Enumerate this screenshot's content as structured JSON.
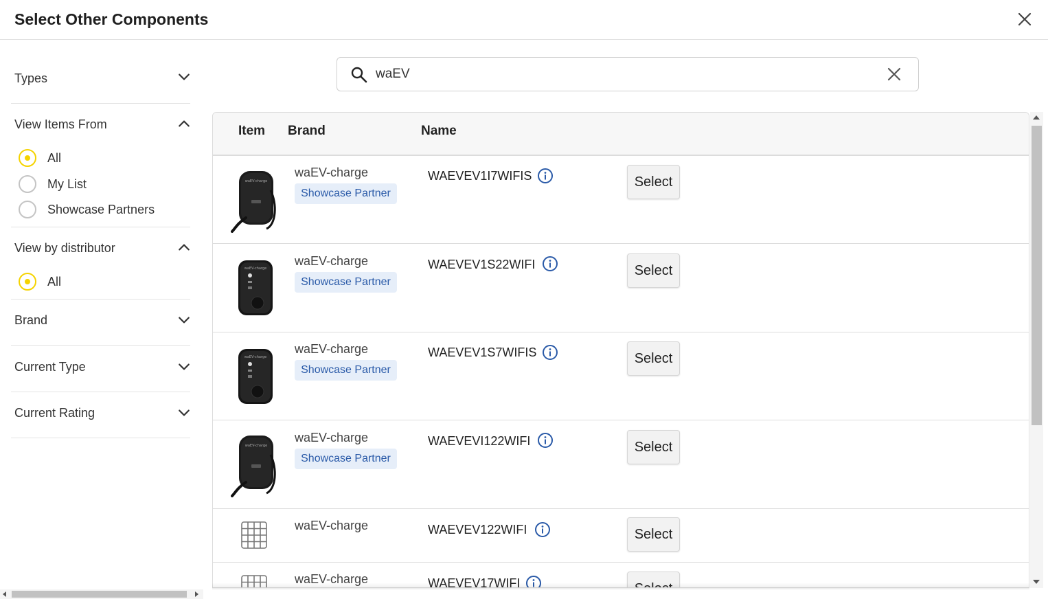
{
  "dialog": {
    "title": "Select Other Components"
  },
  "filters": {
    "types": "Types",
    "view_items_from": {
      "title": "View Items From",
      "options": [
        "All",
        "My List",
        "Showcase Partners"
      ],
      "selected": "All"
    },
    "view_by_distributor": {
      "title": "View by distributor",
      "options": [
        "All"
      ],
      "selected": "All"
    },
    "brand": "Brand",
    "current_type": "Current Type",
    "current_rating": "Current Rating"
  },
  "search": {
    "value": "waEV",
    "placeholder": ""
  },
  "table": {
    "columns": {
      "item": "Item",
      "brand": "Brand",
      "name": "Name"
    },
    "select_label": "Select",
    "rows": [
      {
        "thumb": "ev-charger-cable-icon",
        "brand": "waEV-charge",
        "badge": "Showcase Partner",
        "name": "WAEVEV1I7WIFIS"
      },
      {
        "thumb": "ev-charger-box-icon",
        "brand": "waEV-charge",
        "badge": "Showcase Partner",
        "name": "WAEVEV1S22WIFI"
      },
      {
        "thumb": "ev-charger-box-icon",
        "brand": "waEV-charge",
        "badge": "Showcase Partner",
        "name": "WAEVEV1S7WIFIS"
      },
      {
        "thumb": "ev-charger-cable-icon",
        "brand": "waEV-charge",
        "badge": "Showcase Partner",
        "name": "WAEVEVI122WIFI"
      },
      {
        "thumb": "grid-placeholder-icon",
        "brand": "waEV-charge",
        "badge": "",
        "name": "WAEVEV122WIFI"
      },
      {
        "thumb": "grid-placeholder-icon",
        "brand": "waEV-charge",
        "badge": "",
        "name": "WAEVEV17WIFI"
      }
    ]
  },
  "colors": {
    "radio_selected": "#f5d300",
    "badge_bg": "#e6eef9",
    "badge_text": "#2a5aa8",
    "info_icon": "#2a5aa8"
  }
}
